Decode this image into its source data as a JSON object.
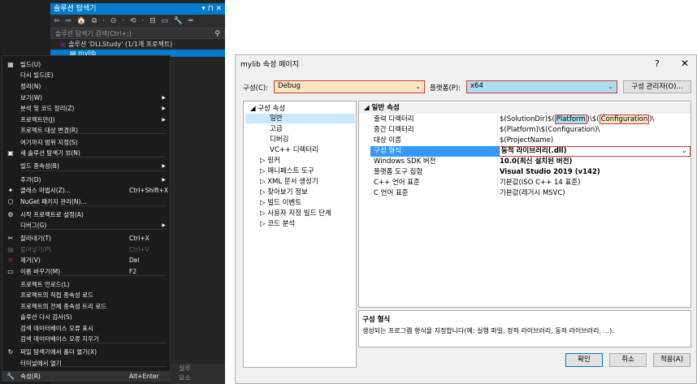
{
  "solution_explorer": {
    "title": "솔루션 탐색기",
    "title_controls": "▾ ⊓ ✕",
    "toolbar_icons": "⇦ ⇨ 🏠 ⧉ · ⊙ · ⟲ · ⊟ ▭ 🔧 ═",
    "search_placeholder": "솔루션 탐색기 검색(Ctrl+;)",
    "solution_label": "솔루션 'DLLStudy' (1/1개 프로젝트)",
    "project_label": "mylib"
  },
  "context_menu": {
    "items": [
      {
        "icon": "▦",
        "label": "빌드(U)",
        "shortcut": "",
        "arrow": "",
        "disabled": false
      },
      {
        "icon": "",
        "label": "다시 빌드(E)",
        "shortcut": "",
        "arrow": "",
        "disabled": false
      },
      {
        "icon": "",
        "label": "정리(N)",
        "shortcut": "",
        "arrow": "",
        "disabled": false
      },
      {
        "icon": "",
        "label": "보기(W)",
        "shortcut": "",
        "arrow": "▶",
        "disabled": false
      },
      {
        "icon": "",
        "label": "분석 및 코드 정리(Z)",
        "shortcut": "",
        "arrow": "▶",
        "disabled": false
      },
      {
        "icon": "",
        "label": "프로젝트만(J)",
        "shortcut": "",
        "arrow": "▶",
        "disabled": false
      },
      {
        "icon": "",
        "label": "프로젝트 대상 변경(R)",
        "shortcut": "",
        "arrow": "",
        "disabled": false
      },
      {
        "icon": "",
        "label": "여기까지 범위 지정(S)",
        "shortcut": "",
        "arrow": "",
        "disabled": false
      },
      {
        "icon": "▣",
        "label": "새 솔루션 탐색기 뷰(N)",
        "shortcut": "",
        "arrow": "",
        "disabled": false
      },
      {
        "icon": "",
        "label": "빌드 종속성(B)",
        "shortcut": "",
        "arrow": "▶",
        "disabled": false
      },
      {
        "icon": "",
        "label": "추가(D)",
        "shortcut": "",
        "arrow": "▶",
        "disabled": false
      },
      {
        "icon": "✦",
        "label": "클래스 마법사(Z)...",
        "shortcut": "Ctrl+Shift+X",
        "arrow": "",
        "disabled": false
      },
      {
        "icon": "⬡",
        "label": "NuGet 패키지 관리(N)...",
        "shortcut": "",
        "arrow": "",
        "disabled": false
      },
      {
        "icon": "⚙",
        "label": "시작 프로젝트로 설정(A)",
        "shortcut": "",
        "arrow": "",
        "disabled": false
      },
      {
        "icon": "",
        "label": "디버그(G)",
        "shortcut": "",
        "arrow": "▶",
        "disabled": false
      },
      {
        "icon": "✂",
        "label": "잘라내기(T)",
        "shortcut": "Ctrl+X",
        "arrow": "",
        "disabled": false
      },
      {
        "icon": "▤",
        "label": "붙여넣기(P)",
        "shortcut": "Ctrl+V",
        "arrow": "",
        "disabled": true
      },
      {
        "icon": "✕",
        "label": "제거(V)",
        "shortcut": "Del",
        "arrow": "",
        "disabled": false
      },
      {
        "icon": "▭",
        "label": "이름 바꾸기(M)",
        "shortcut": "F2",
        "arrow": "",
        "disabled": false
      },
      {
        "icon": "",
        "label": "프로젝트 언로드(L)",
        "shortcut": "",
        "arrow": "",
        "disabled": false
      },
      {
        "icon": "",
        "label": "프로젝트의 직접 종속성 로드",
        "shortcut": "",
        "arrow": "",
        "disabled": false
      },
      {
        "icon": "",
        "label": "프로젝트의 전체 종속성 트리 로드",
        "shortcut": "",
        "arrow": "",
        "disabled": false
      },
      {
        "icon": "",
        "label": "솔루션 다시 검사(S)",
        "shortcut": "",
        "arrow": "",
        "disabled": false
      },
      {
        "icon": "",
        "label": "검색 데이터베이스 오류 표시",
        "shortcut": "",
        "arrow": "",
        "disabled": false
      },
      {
        "icon": "",
        "label": "검색 데이터베이스 오류 지우기",
        "shortcut": "",
        "arrow": "",
        "disabled": false
      },
      {
        "icon": "↻",
        "label": "파일 탐색기에서 폴더 열기(X)",
        "shortcut": "",
        "arrow": "",
        "disabled": false
      },
      {
        "icon": "",
        "label": "터미널에서 열기",
        "shortcut": "",
        "arrow": "",
        "disabled": false
      },
      {
        "icon": "🔧",
        "label": "속성(R)",
        "shortcut": "Alt+Enter",
        "arrow": "",
        "disabled": false
      }
    ]
  },
  "bottom_strip": {
    "text1": "실루",
    "text2": "요소"
  },
  "dialog": {
    "title": "mylib 속성 페이지",
    "help": "?",
    "close": "✕",
    "config_label": "구성(C):",
    "config_value": "Debug",
    "platform_label": "플랫폼(P):",
    "platform_value": "x64",
    "config_manager": "구성 관리자(O)...",
    "tree": [
      {
        "label": "◢ 구성 속성"
      },
      {
        "label": "일반"
      },
      {
        "label": "고급"
      },
      {
        "label": "디버깅"
      },
      {
        "label": "VC++ 디렉터리"
      },
      {
        "label": "▷ 링커"
      },
      {
        "label": "▷ 매니페스트 도구"
      },
      {
        "label": "▷ XML 문서 생성기"
      },
      {
        "label": "▷ 찾아보기 정보"
      },
      {
        "label": "▷ 빌드 이벤트"
      },
      {
        "label": "▷ 사용자 지정 빌드 단계"
      },
      {
        "label": "▷ 코드 분석"
      }
    ],
    "grid_category": "◢ 일반 속성",
    "rows": [
      {
        "name": "출력 디렉터리",
        "value_prefix": "$(SolutionDir)$(",
        "value_platform": "Platform",
        "value_mid": ")\\$(",
        "value_config": "Configuration",
        "value_suffix": ")\\"
      },
      {
        "name": "중간 디렉터리",
        "value": "$(Platform)\\$(Configuration)\\"
      },
      {
        "name": "대상 이름",
        "value": "$(ProjectName)"
      },
      {
        "name": "구성 형식",
        "value": "동적 라이브러리(.dll)"
      },
      {
        "name": "Windows SDK 버전",
        "value": "10.0(최신 설치된 버전)"
      },
      {
        "name": "플랫폼 도구 집합",
        "value": "Visual Studio 2019 (v142)"
      },
      {
        "name": "C++ 언어 표준",
        "value": "기본값(ISO C++ 14 표준)"
      },
      {
        "name": "C 언어 표준",
        "value": "기본값(레거시 MSVC)"
      }
    ],
    "desc_title": "구성 형식",
    "desc_text": "생성되는 프로그램 형식을 지정합니다(예: 실행 파일, 정적 라이브러리, 동적 라이브러리, ...).",
    "ok": "확인",
    "cancel": "취소",
    "apply": "적용(A)"
  }
}
